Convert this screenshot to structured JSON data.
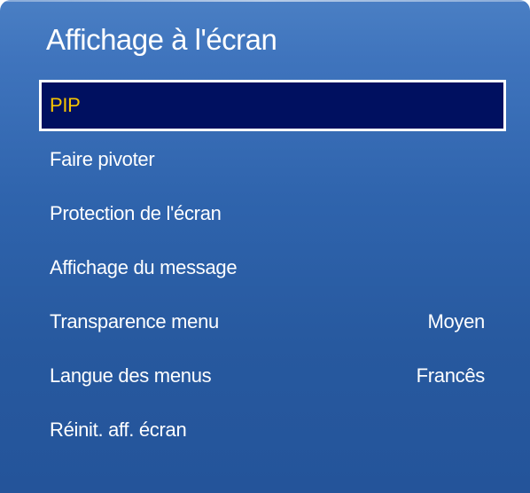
{
  "menu": {
    "title": "Affichage à l'écran",
    "items": [
      {
        "label": "PIP",
        "value": "",
        "selected": true
      },
      {
        "label": "Faire pivoter",
        "value": ""
      },
      {
        "label": "Protection de l'écran",
        "value": ""
      },
      {
        "label": "Affichage du message",
        "value": ""
      },
      {
        "label": "Transparence menu",
        "value": "Moyen"
      },
      {
        "label": "Langue des menus",
        "value": "Francês"
      },
      {
        "label": "Réinit. aff. écran",
        "value": ""
      }
    ]
  },
  "colors": {
    "panel_blue": "#2f64ad",
    "selected_bg": "#001060",
    "selected_text": "#f5c400",
    "text": "#ffffff"
  }
}
